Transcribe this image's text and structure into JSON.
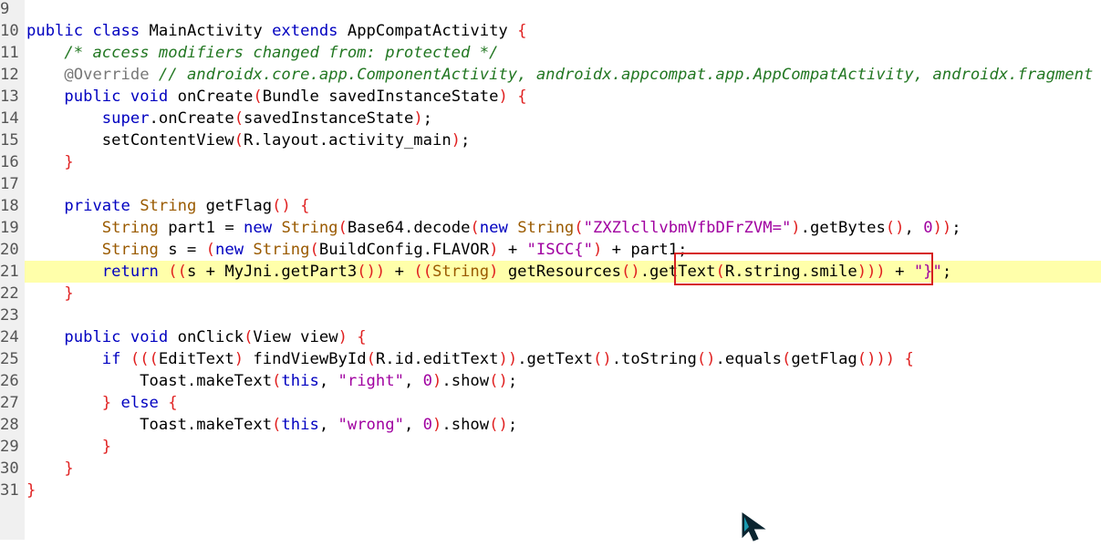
{
  "editor": {
    "highlighted_line": 21,
    "lines": [
      {
        "n": "9",
        "tokens": []
      },
      {
        "n": "10",
        "tokens": [
          [
            "kw",
            "public"
          ],
          [
            "id",
            " "
          ],
          [
            "kw",
            "class"
          ],
          [
            "id",
            " MainActivity "
          ],
          [
            "kw",
            "extends"
          ],
          [
            "id",
            " AppCompatActivity "
          ],
          [
            "pr",
            "{"
          ]
        ]
      },
      {
        "n": "11",
        "tokens": [
          [
            "id",
            "    "
          ],
          [
            "cm",
            "/* access modifiers changed from: protected */"
          ]
        ]
      },
      {
        "n": "12",
        "tokens": [
          [
            "id",
            "    "
          ],
          [
            "an",
            "@Override"
          ],
          [
            "id",
            " "
          ],
          [
            "cm",
            "// androidx.core.app.ComponentActivity, androidx.appcompat.app.AppCompatActivity, androidx.fragment"
          ]
        ]
      },
      {
        "n": "13",
        "tokens": [
          [
            "id",
            "    "
          ],
          [
            "kw",
            "public"
          ],
          [
            "id",
            " "
          ],
          [
            "kw",
            "void"
          ],
          [
            "id",
            " onCreate"
          ],
          [
            "pr",
            "("
          ],
          [
            "id",
            "Bundle savedInstanceState"
          ],
          [
            "pr",
            ")"
          ],
          [
            "id",
            " "
          ],
          [
            "pr",
            "{"
          ]
        ]
      },
      {
        "n": "14",
        "tokens": [
          [
            "id",
            "        "
          ],
          [
            "kw",
            "super"
          ],
          [
            "id",
            ".onCreate"
          ],
          [
            "pr",
            "("
          ],
          [
            "id",
            "savedInstanceState"
          ],
          [
            "pr",
            ")"
          ],
          [
            "id",
            ";"
          ]
        ]
      },
      {
        "n": "15",
        "tokens": [
          [
            "id",
            "        setContentView"
          ],
          [
            "pr",
            "("
          ],
          [
            "id",
            "R.layout.activity_main"
          ],
          [
            "pr",
            ")"
          ],
          [
            "id",
            ";"
          ]
        ]
      },
      {
        "n": "16",
        "tokens": [
          [
            "id",
            "    "
          ],
          [
            "pr",
            "}"
          ]
        ]
      },
      {
        "n": "17",
        "tokens": []
      },
      {
        "n": "18",
        "tokens": [
          [
            "id",
            "    "
          ],
          [
            "kw",
            "private"
          ],
          [
            "id",
            " "
          ],
          [
            "ty",
            "String"
          ],
          [
            "id",
            " getFlag"
          ],
          [
            "pr",
            "()"
          ],
          [
            "id",
            " "
          ],
          [
            "pr",
            "{"
          ]
        ]
      },
      {
        "n": "19",
        "tokens": [
          [
            "id",
            "        "
          ],
          [
            "ty",
            "String"
          ],
          [
            "id",
            " part1 = "
          ],
          [
            "kw",
            "new"
          ],
          [
            "id",
            " "
          ],
          [
            "ty",
            "String"
          ],
          [
            "pr",
            "("
          ],
          [
            "id",
            "Base64.decode"
          ],
          [
            "pr",
            "("
          ],
          [
            "kw",
            "new"
          ],
          [
            "id",
            " "
          ],
          [
            "ty",
            "String"
          ],
          [
            "pr",
            "("
          ],
          [
            "st",
            "\"ZXZlcllvbmVfbDFrZVM=\""
          ],
          [
            "pr",
            ")"
          ],
          [
            "id",
            ".getBytes"
          ],
          [
            "pr",
            "()"
          ],
          [
            "id",
            ", "
          ],
          [
            "nm",
            "0"
          ],
          [
            "pr",
            "))"
          ],
          [
            "id",
            ";"
          ]
        ]
      },
      {
        "n": "20",
        "tokens": [
          [
            "id",
            "        "
          ],
          [
            "ty",
            "String"
          ],
          [
            "id",
            " s = "
          ],
          [
            "pr",
            "("
          ],
          [
            "kw",
            "new"
          ],
          [
            "id",
            " "
          ],
          [
            "ty",
            "String"
          ],
          [
            "pr",
            "("
          ],
          [
            "id",
            "BuildConfig.FLAVOR"
          ],
          [
            "pr",
            ")"
          ],
          [
            "id",
            " + "
          ],
          [
            "st",
            "\"ISCC{\""
          ],
          [
            "pr",
            ")"
          ],
          [
            "id",
            " + part1;"
          ]
        ]
      },
      {
        "n": "21",
        "tokens": [
          [
            "id",
            "        "
          ],
          [
            "kw",
            "return"
          ],
          [
            "id",
            " "
          ],
          [
            "pr",
            "(("
          ],
          [
            "id",
            "s + MyJni.getPart3"
          ],
          [
            "pr",
            "())"
          ],
          [
            "id",
            " + "
          ],
          [
            "pr",
            "(("
          ],
          [
            "ty",
            "String"
          ],
          [
            "pr",
            ")"
          ],
          [
            "id",
            " getResources"
          ],
          [
            "pr",
            "()"
          ],
          [
            "id",
            ".getText"
          ],
          [
            "pr",
            "("
          ],
          [
            "id",
            "R.string.smile"
          ],
          [
            "pr",
            ")))"
          ],
          [
            "id",
            " + "
          ],
          [
            "st",
            "\"}\""
          ],
          [
            "id",
            ";"
          ]
        ]
      },
      {
        "n": "22",
        "tokens": [
          [
            "id",
            "    "
          ],
          [
            "pr",
            "}"
          ]
        ]
      },
      {
        "n": "23",
        "tokens": []
      },
      {
        "n": "24",
        "tokens": [
          [
            "id",
            "    "
          ],
          [
            "kw",
            "public"
          ],
          [
            "id",
            " "
          ],
          [
            "kw",
            "void"
          ],
          [
            "id",
            " onClick"
          ],
          [
            "pr",
            "("
          ],
          [
            "id",
            "View view"
          ],
          [
            "pr",
            ")"
          ],
          [
            "id",
            " "
          ],
          [
            "pr",
            "{"
          ]
        ]
      },
      {
        "n": "25",
        "tokens": [
          [
            "id",
            "        "
          ],
          [
            "kw",
            "if"
          ],
          [
            "id",
            " "
          ],
          [
            "pr",
            "((("
          ],
          [
            "id",
            "EditText"
          ],
          [
            "pr",
            ")"
          ],
          [
            "id",
            " findViewById"
          ],
          [
            "pr",
            "("
          ],
          [
            "id",
            "R.id.editText"
          ],
          [
            "pr",
            "))"
          ],
          [
            "id",
            ".getText"
          ],
          [
            "pr",
            "()"
          ],
          [
            "id",
            ".toString"
          ],
          [
            "pr",
            "()"
          ],
          [
            "id",
            ".equals"
          ],
          [
            "pr",
            "("
          ],
          [
            "id",
            "getFlag"
          ],
          [
            "pr",
            "()))"
          ],
          [
            "id",
            " "
          ],
          [
            "pr",
            "{"
          ]
        ]
      },
      {
        "n": "26",
        "tokens": [
          [
            "id",
            "            Toast.makeText"
          ],
          [
            "pr",
            "("
          ],
          [
            "kw",
            "this"
          ],
          [
            "id",
            ", "
          ],
          [
            "st",
            "\"right\""
          ],
          [
            "id",
            ", "
          ],
          [
            "nm",
            "0"
          ],
          [
            "pr",
            ")"
          ],
          [
            "id",
            ".show"
          ],
          [
            "pr",
            "()"
          ],
          [
            "id",
            ";"
          ]
        ]
      },
      {
        "n": "27",
        "tokens": [
          [
            "id",
            "        "
          ],
          [
            "pr",
            "}"
          ],
          [
            "id",
            " "
          ],
          [
            "kw",
            "else"
          ],
          [
            "id",
            " "
          ],
          [
            "pr",
            "{"
          ]
        ]
      },
      {
        "n": "28",
        "tokens": [
          [
            "id",
            "            Toast.makeText"
          ],
          [
            "pr",
            "("
          ],
          [
            "kw",
            "this"
          ],
          [
            "id",
            ", "
          ],
          [
            "st",
            "\"wrong\""
          ],
          [
            "id",
            ", "
          ],
          [
            "nm",
            "0"
          ],
          [
            "pr",
            ")"
          ],
          [
            "id",
            ".show"
          ],
          [
            "pr",
            "()"
          ],
          [
            "id",
            ";"
          ]
        ]
      },
      {
        "n": "29",
        "tokens": [
          [
            "id",
            "        "
          ],
          [
            "pr",
            "}"
          ]
        ]
      },
      {
        "n": "30",
        "tokens": [
          [
            "id",
            "    "
          ],
          [
            "pr",
            "}"
          ]
        ]
      },
      {
        "n": "31",
        "tokens": [
          [
            "pr",
            "}"
          ]
        ]
      }
    ]
  },
  "annotation": {
    "box_color": "#d62020"
  },
  "icons": {
    "cursor": "mouse-pointer-icon"
  }
}
